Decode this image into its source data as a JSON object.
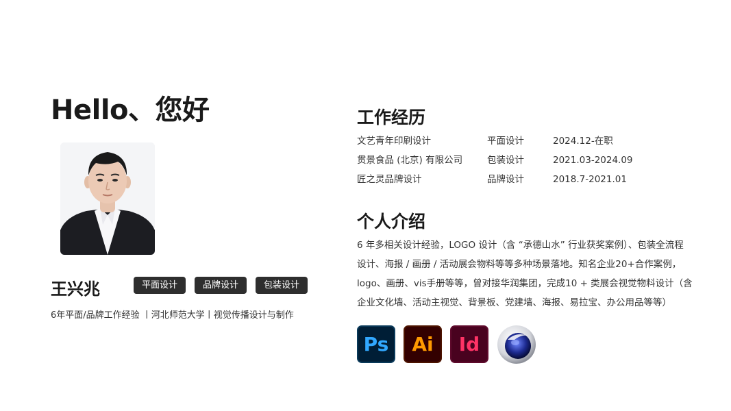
{
  "greeting": "Hello、您好",
  "profile": {
    "name": "王兴兆",
    "tags": [
      "平面设计",
      "品牌设计",
      "包装设计"
    ],
    "subline": "6年平面/品牌工作经验 丨河北师范大学丨视觉传播设计与制作"
  },
  "experience": {
    "title": "工作经历",
    "rows": [
      {
        "company": "文艺青年印刷设计",
        "role": "平面设计",
        "date": "2024.12-在职"
      },
      {
        "company": "贯景食品 (北京) 有限公司",
        "role": "包装设计",
        "date": "2021.03-2024.09"
      },
      {
        "company": "匠之灵品牌设计",
        "role": "品牌设计",
        "date": "2018.7-2021.01"
      }
    ]
  },
  "intro": {
    "title": "个人介绍",
    "lines": [
      "6 年多相关设计经验，LOGO 设计（含 “承德山水” 行业获奖案例）、包装全流程",
      "设计、海报 / 画册 / 活动展会物料等等多种场景落地。知名企业20+合作案例，",
      "logo、画册、vis手册等等，曾对接华润集团，完成10 + 类展会视觉物料设计（含",
      "企业文化墙、活动主视觉、背景板、党建墙、海报、易拉宝、办公用品等等）"
    ]
  },
  "tools": [
    {
      "label": "Ps",
      "icon": "photoshop-icon",
      "color": "#31a8ff",
      "bg": "#001e36"
    },
    {
      "label": "Ai",
      "icon": "illustrator-icon",
      "color": "#ff9a00",
      "bg": "#330000"
    },
    {
      "label": "Id",
      "icon": "indesign-icon",
      "color": "#ff3366",
      "bg": "#49021f"
    },
    {
      "label": "",
      "icon": "cinema4d-icon",
      "color": "#3b4fd8",
      "bg": "#e8e8ec"
    }
  ]
}
